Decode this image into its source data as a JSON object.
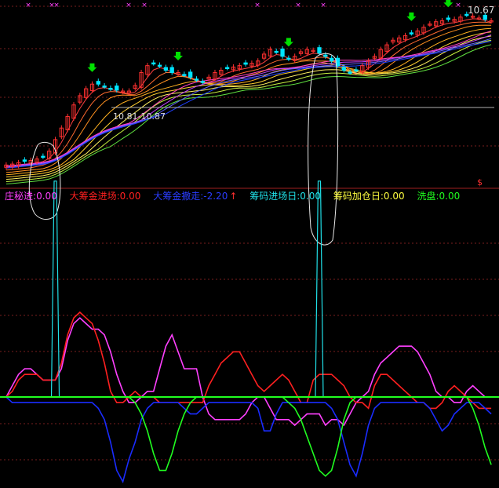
{
  "colors": {
    "background": "#000000",
    "grid": "#7a1e1e",
    "up_candle": "#ff3030",
    "down_candle": "#00e5ff",
    "pink_line": "#ff40ff",
    "red_line": "#ff2020",
    "blue_line": "#1a2cff",
    "green_line": "#20ff20",
    "cyan_line": "#20e0e8",
    "signal_arrow": "#00e000",
    "sell_marker": "#ff40ff"
  },
  "main_panel": {
    "range_label": "10.81-10.87",
    "high_label": "10.67",
    "corner_marker": "$"
  },
  "legend": [
    {
      "label": "庄秘进",
      "value": "0.00",
      "color": "#ff40ff"
    },
    {
      "label": "大筹金进场",
      "value": "0.00",
      "color": "#ff2020"
    },
    {
      "label": "大筹金撤走",
      "value": "-2.20",
      "color": "#2a3cff"
    },
    {
      "label": "筹码进场日",
      "value": "0.00",
      "color": "#20e0e8"
    },
    {
      "label": "筹码加仓日",
      "value": "0.00",
      "color": "#ffff40"
    },
    {
      "label": "洗盘",
      "value": "0.00",
      "color": "#20ff20"
    }
  ],
  "chart_data": [
    {
      "type": "candlestick",
      "panel": "price",
      "price_range": [
        7.5,
        11.2
      ],
      "range_annotation": "10.81-10.87",
      "high_annotation": "10.67",
      "closes": [
        7.8,
        7.82,
        7.85,
        7.88,
        7.9,
        7.93,
        7.98,
        8.1,
        8.35,
        8.6,
        8.85,
        9.1,
        9.3,
        9.45,
        9.55,
        9.55,
        9.5,
        9.45,
        9.42,
        9.4,
        9.4,
        9.52,
        9.8,
        9.95,
        10.0,
        9.95,
        9.85,
        9.8,
        9.8,
        9.75,
        9.7,
        9.65,
        9.6,
        9.7,
        9.8,
        9.85,
        9.9,
        9.92,
        9.95,
        9.98,
        10.0,
        10.05,
        10.2,
        10.3,
        10.25,
        10.15,
        10.1,
        10.15,
        10.25,
        10.3,
        10.28,
        10.22,
        10.15,
        10.05,
        9.95,
        9.85,
        9.8,
        9.85,
        9.95,
        10.05,
        10.15,
        10.3,
        10.4,
        10.5,
        10.55,
        10.6,
        10.65,
        10.7,
        10.78,
        10.85,
        10.9,
        10.92,
        10.95,
        10.95,
        11.0,
        11.05,
        11.02,
        10.98,
        10.95,
        10.92
      ],
      "buy_signal_bars": [
        14,
        28,
        46,
        66,
        72
      ],
      "moving_averages": {
        "line_count": 12,
        "colors": [
          "#ff4040",
          "#ff6a30",
          "#ff9020",
          "#ffb020",
          "#ffd030",
          "#fff060",
          "#c8f040",
          "#60e040",
          "#ff40c0",
          "#c040ff",
          "#6060ff",
          "#2040ff"
        ]
      }
    },
    {
      "type": "line",
      "panel": "indicator",
      "y_range": [
        -16,
        16
      ],
      "zero_line": 0,
      "series": [
        {
          "name": "庄秘进",
          "color": "#ff40ff",
          "values": [
            0,
            2,
            4,
            5,
            5,
            4,
            3,
            3,
            3,
            5,
            10,
            13,
            14,
            13,
            12,
            12,
            11,
            8,
            4,
            1,
            -1,
            -1,
            0,
            1,
            1,
            5,
            9,
            11,
            8,
            5,
            5,
            5,
            0,
            -3,
            -4,
            -4,
            -4,
            -4,
            -4,
            -3,
            -1,
            0,
            0,
            -2,
            -4,
            -4,
            -4,
            -5,
            -4,
            -3,
            -3,
            -3,
            -5,
            -4,
            -4,
            -5,
            -3,
            -1,
            0,
            1,
            4,
            6,
            7,
            8,
            9,
            9,
            9,
            8,
            6,
            4,
            1,
            0,
            0,
            -1,
            -1,
            1,
            2,
            1,
            0,
            0
          ]
        },
        {
          "name": "大筹金进场",
          "color": "#ff2020",
          "values": [
            0,
            1,
            3,
            4,
            4,
            4,
            3,
            3,
            3,
            6,
            11,
            14,
            15,
            14,
            13,
            10,
            6,
            1,
            -1,
            -1,
            0,
            1,
            0,
            0,
            0,
            -1,
            -1,
            -1,
            -1,
            -1,
            -1,
            -1,
            -1,
            2,
            4,
            6,
            7,
            8,
            8,
            6,
            4,
            2,
            1,
            2,
            3,
            4,
            3,
            1,
            -1,
            -1,
            3,
            4,
            4,
            4,
            3,
            2,
            0,
            -1,
            -1,
            -2,
            2,
            4,
            4,
            3,
            2,
            1,
            0,
            -1,
            -1,
            -2,
            -2,
            -1,
            1,
            2,
            1,
            0,
            -1,
            -2,
            -2,
            -2
          ]
        },
        {
          "name": "大筹金撤走",
          "color": "#1a2cff",
          "values": [
            0,
            -1,
            -1,
            -1,
            -1,
            -1,
            -1,
            -1,
            -1,
            -1,
            -1,
            -1,
            -1,
            -1,
            -1,
            -2,
            -4,
            -8,
            -13,
            -15,
            -11,
            -8,
            -4,
            -2,
            -1,
            -1,
            -1,
            -1,
            -1,
            -2,
            -3,
            -3,
            -2,
            -1,
            -1,
            -1,
            -1,
            -1,
            -1,
            -1,
            -1,
            -2,
            -6,
            -6,
            -3,
            -1,
            -1,
            -1,
            -1,
            -1,
            -1,
            -1,
            -1,
            -2,
            -4,
            -8,
            -12,
            -14,
            -10,
            -5,
            -2,
            -1,
            -1,
            -1,
            -1,
            -1,
            -1,
            -1,
            -1,
            -2,
            -4,
            -6,
            -5,
            -3,
            -2,
            -1,
            -1,
            -1,
            -2,
            -3
          ]
        },
        {
          "name": "洗盘",
          "color": "#20ff20",
          "values": [
            0,
            0,
            0,
            0,
            0,
            0,
            0,
            0,
            0,
            0,
            0,
            0,
            0,
            0,
            0,
            0,
            0,
            0,
            0,
            0,
            0,
            -1,
            -3,
            -6,
            -10,
            -13,
            -13,
            -10,
            -6,
            -3,
            -1,
            0,
            0,
            0,
            0,
            0,
            0,
            0,
            0,
            0,
            0,
            0,
            0,
            0,
            0,
            0,
            -1,
            -2,
            -4,
            -7,
            -10,
            -13,
            -14,
            -13,
            -9,
            -4,
            -1,
            0,
            0,
            0,
            0,
            0,
            0,
            0,
            0,
            0,
            0,
            0,
            0,
            0,
            0,
            0,
            0,
            0,
            0,
            0,
            -2,
            -5,
            -9,
            -12
          ]
        },
        {
          "name": "筹码进场日",
          "color": "#20e0e8",
          "spike_bars": [
            8,
            51
          ],
          "spike_values": [
            16,
            16
          ]
        }
      ]
    }
  ]
}
